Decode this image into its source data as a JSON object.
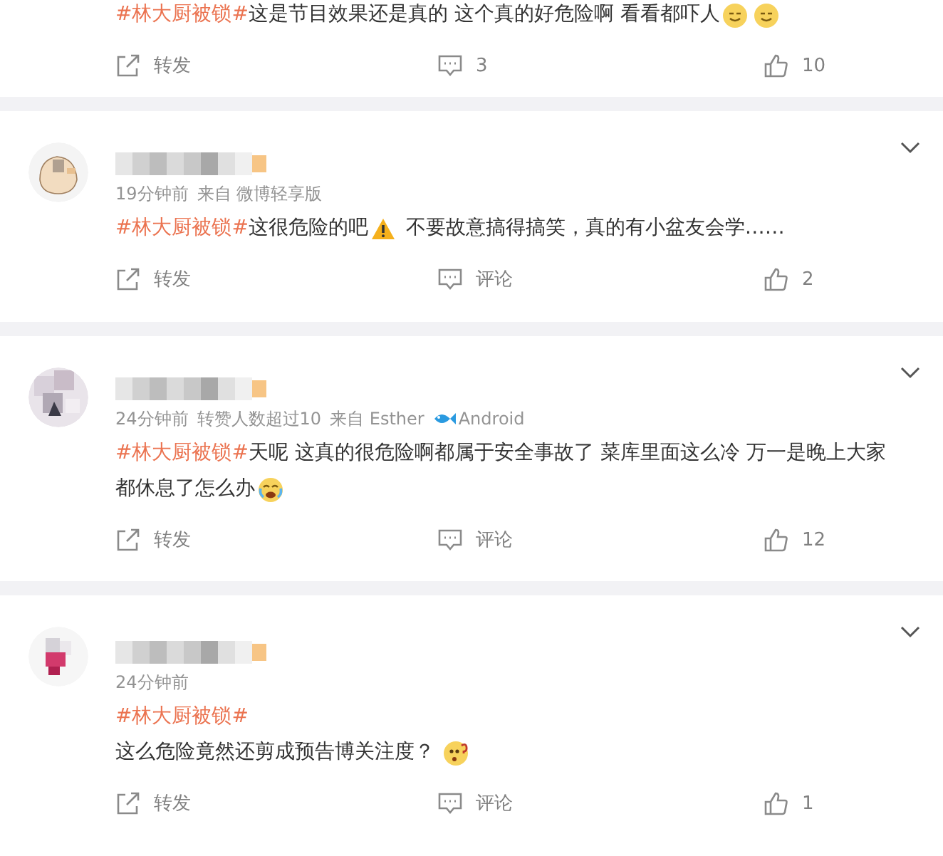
{
  "comments": [
    {
      "lines": [
        [
          {
            "kind": "topic",
            "text": "#林大厨被锁#"
          },
          {
            "kind": "text",
            "text": "这是节目效果还是真的 这个真的好危险啊 看看都吓人"
          },
          {
            "kind": "smile"
          },
          {
            "kind": "smile"
          }
        ]
      ],
      "actions": {
        "forward": "转发",
        "comment": "3",
        "like": "10"
      }
    },
    {
      "meta": [
        {
          "kind": "text",
          "text": "19分钟前"
        },
        {
          "kind": "text",
          "text": "来自 微博轻享版"
        }
      ],
      "lines": [
        [
          {
            "kind": "topic",
            "text": "#林大厨被锁#"
          },
          {
            "kind": "text",
            "text": "这很危险的吧"
          },
          {
            "kind": "warning"
          },
          {
            "kind": "text",
            "text": " 不要故意搞得搞笑，真的有小盆友会学……"
          }
        ]
      ],
      "actions": {
        "forward": "转发",
        "comment": "评论",
        "like": "2"
      }
    },
    {
      "meta": [
        {
          "kind": "text",
          "text": "24分钟前"
        },
        {
          "kind": "text",
          "text": "转赞人数超过10"
        },
        {
          "kind": "text",
          "text": "来自 Esther"
        },
        {
          "kind": "fish"
        },
        {
          "kind": "text",
          "text": "Android"
        }
      ],
      "lines": [
        [
          {
            "kind": "topic",
            "text": "#林大厨被锁#"
          },
          {
            "kind": "text",
            "text": "天呢 这真的很危险啊都属于安全事故了 菜库里面这么冷 万一是晚上大家"
          }
        ],
        [
          {
            "kind": "text",
            "text": "都休息了怎么办"
          },
          {
            "kind": "cry"
          }
        ]
      ],
      "actions": {
        "forward": "转发",
        "comment": "评论",
        "like": "12"
      }
    },
    {
      "meta": [
        {
          "kind": "text",
          "text": "24分钟前"
        }
      ],
      "lines": [
        [
          {
            "kind": "topic",
            "text": "#林大厨被锁#"
          }
        ],
        [
          {
            "kind": "text",
            "text": "这么危险竟然还剪成预告博关注度？ "
          },
          {
            "kind": "question"
          }
        ]
      ],
      "actions": {
        "forward": "转发",
        "comment": "评论",
        "like": "1"
      }
    }
  ]
}
